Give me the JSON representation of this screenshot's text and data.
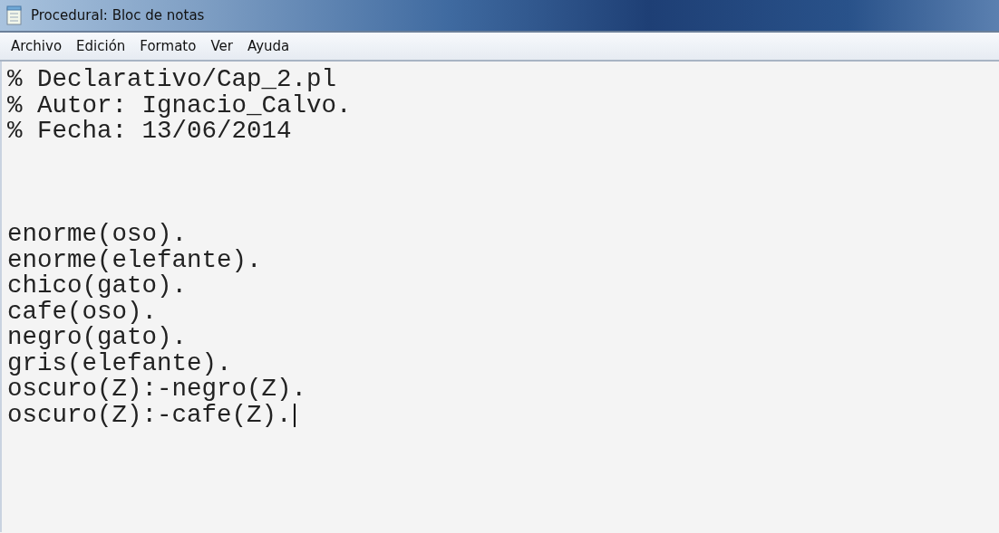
{
  "window": {
    "title": "Procedural: Bloc de notas"
  },
  "menu": [
    "Archivo",
    "Edición",
    "Formato",
    "Ver",
    "Ayuda"
  ],
  "editor": {
    "header_lines": [
      "% Declarativo/Cap_2.pl",
      "% Autor: Ignacio_Calvo.",
      "% Fecha: 13/06/2014"
    ],
    "code_lines": [
      "enorme(oso).",
      "enorme(elefante).",
      "chico(gato).",
      "cafe(oso).",
      "negro(gato).",
      "gris(elefante).",
      "oscuro(Z):-negro(Z).",
      "oscuro(Z):-cafe(Z)."
    ]
  }
}
